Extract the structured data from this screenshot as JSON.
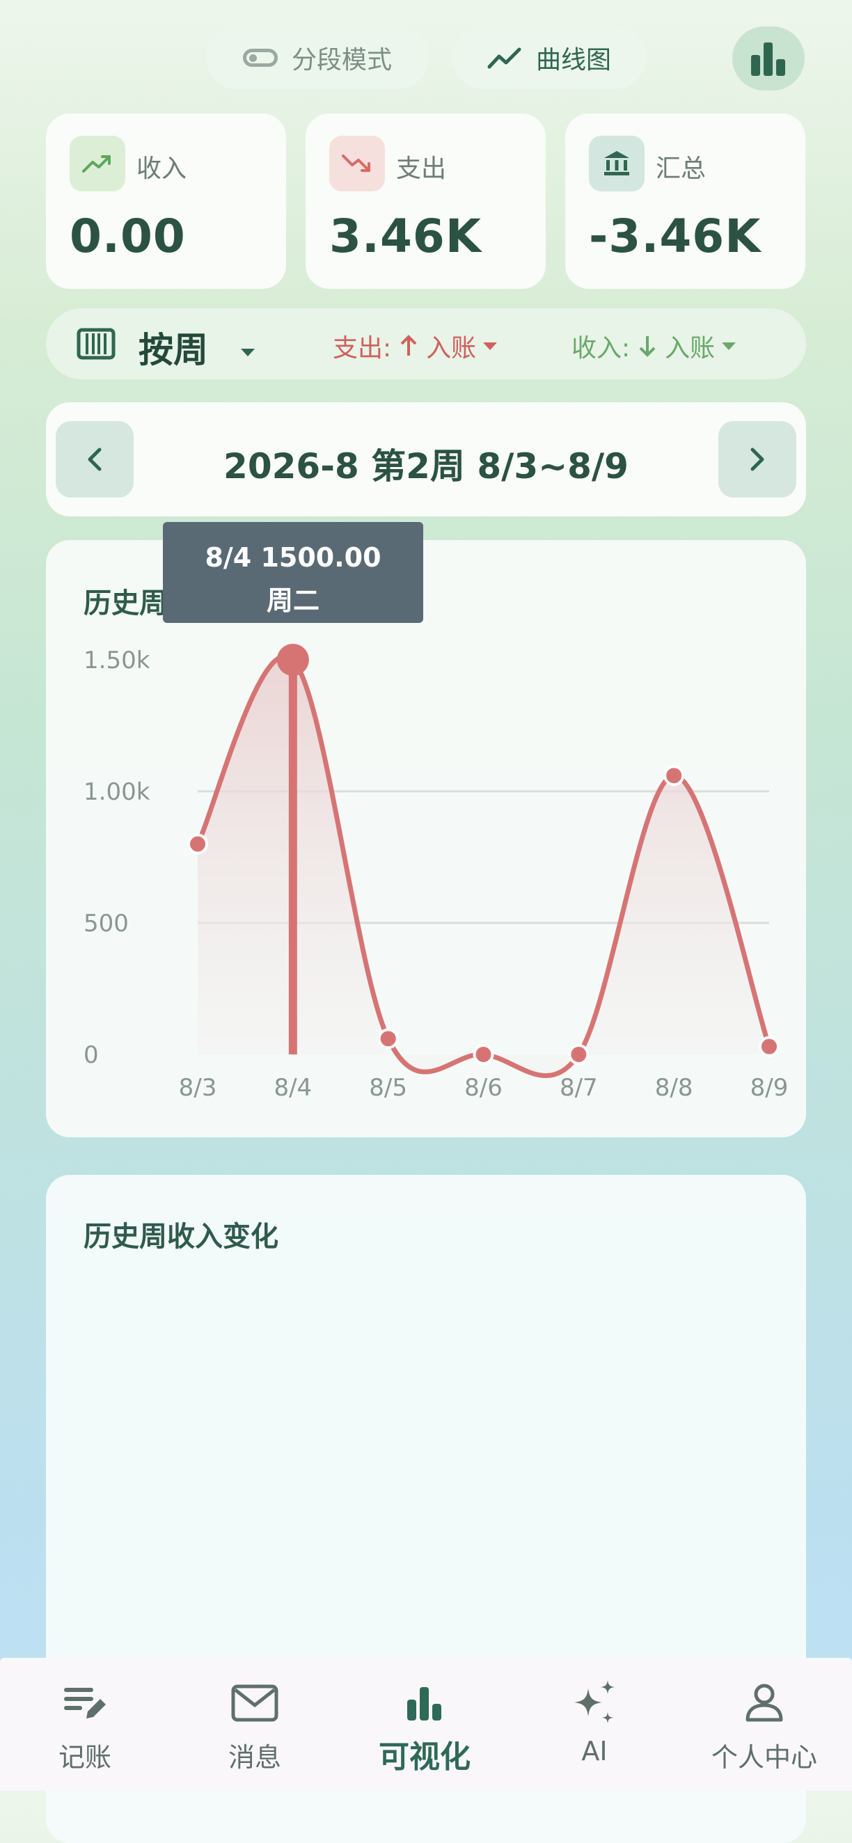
{
  "toolbar": {
    "segment_mode_label": "分段模式",
    "curve_chart_label": "曲线图"
  },
  "summary": {
    "income": {
      "label": "收入",
      "value": "0.00"
    },
    "expense": {
      "label": "支出",
      "value": "3.46K"
    },
    "total": {
      "label": "汇总",
      "value": "-3.46K"
    }
  },
  "filter": {
    "period_label": "按周",
    "expense_prefix": "支出:",
    "expense_value": "入账",
    "income_prefix": "收入:",
    "income_value": "入账"
  },
  "period": {
    "title": "2026-8 第2周 8/3~8/9"
  },
  "expense_chart": {
    "title_visible": "历史周",
    "tooltip_line1": "8/4  1500.00",
    "tooltip_line2": "周二"
  },
  "chart_data": {
    "type": "line",
    "title": "历史周",
    "x": [
      "8/3",
      "8/4",
      "8/5",
      "8/6",
      "8/7",
      "8/8",
      "8/9"
    ],
    "series": [
      {
        "values": [
          800,
          1500,
          60,
          0,
          0,
          1060,
          30
        ]
      }
    ],
    "yticks": [
      "0",
      "500",
      "1.00k",
      "1.50k"
    ],
    "ylim": [
      0,
      1500
    ],
    "grid": true,
    "selected_index": 1,
    "color": "#d67474"
  },
  "income_chart": {
    "title": "历史周收入变化"
  },
  "bottom_nav": {
    "items": [
      {
        "label": "记账",
        "icon": "edit-note-icon"
      },
      {
        "label": "消息",
        "icon": "mail-icon"
      },
      {
        "label": "可视化",
        "icon": "bar-chart-icon"
      },
      {
        "label": "AI",
        "icon": "sparkle-icon"
      },
      {
        "label": "个人中心",
        "icon": "person-icon"
      }
    ],
    "active_index": 2
  },
  "colors": {
    "accent": "#2f6650",
    "expense": "#d0605c",
    "income": "#6aa86a",
    "line": "#d67474"
  }
}
